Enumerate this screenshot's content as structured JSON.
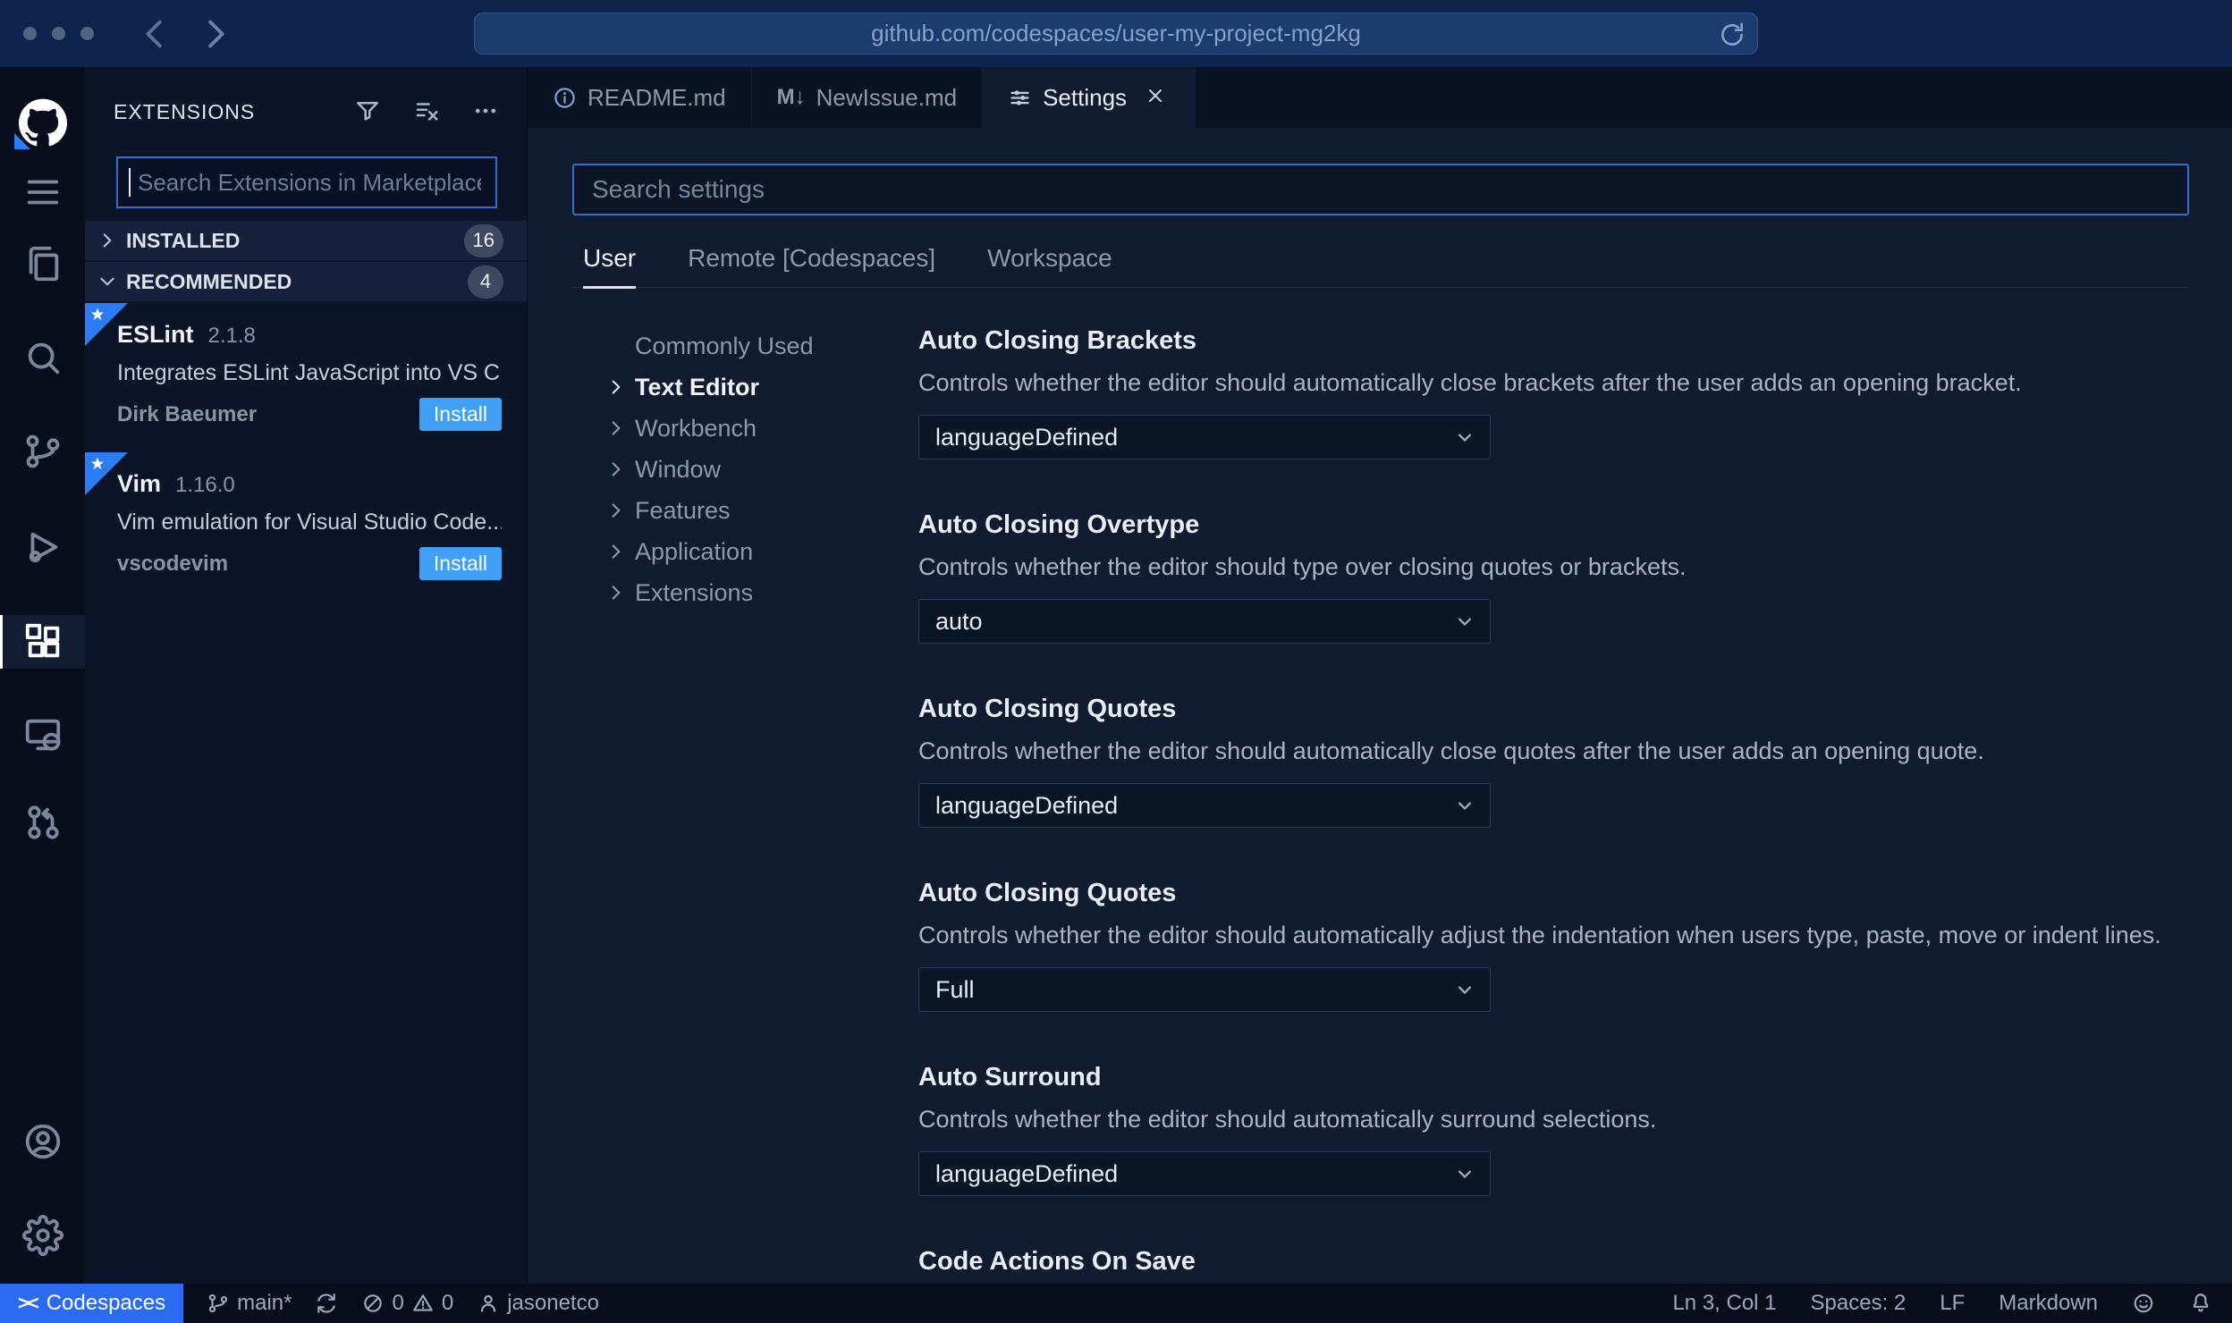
{
  "browser": {
    "url": "github.com/codespaces/user-my-project-mg2kg"
  },
  "sidebar": {
    "title": "EXTENSIONS",
    "search_placeholder": "Search Extensions in Marketplace",
    "sections": [
      {
        "label": "INSTALLED",
        "badge": "16"
      },
      {
        "label": "RECOMMENDED",
        "badge": "4"
      }
    ],
    "extensions": [
      {
        "name": "ESLint",
        "version": "2.1.8",
        "description": "Integrates ESLint JavaScript into VS C...",
        "publisher": "Dirk Baeumer",
        "action": "Install"
      },
      {
        "name": "Vim",
        "version": "1.16.0",
        "description": "Vim emulation for Visual Studio Code...",
        "publisher": "vscodevim",
        "action": "Install"
      }
    ]
  },
  "tabs": [
    {
      "label": "README.md"
    },
    {
      "label": "NewIssue.md",
      "icon_glyph": "M↓"
    },
    {
      "label": "Settings"
    }
  ],
  "settings": {
    "search_placeholder": "Search settings",
    "scopes": [
      {
        "label": "User"
      },
      {
        "label": "Remote [Codespaces]"
      },
      {
        "label": "Workspace"
      }
    ],
    "toc": [
      {
        "label": "Commonly Used"
      },
      {
        "label": "Text Editor"
      },
      {
        "label": "Workbench"
      },
      {
        "label": "Window"
      },
      {
        "label": "Features"
      },
      {
        "label": "Application"
      },
      {
        "label": "Extensions"
      }
    ],
    "items": [
      {
        "title": "Auto Closing Brackets",
        "description": "Controls whether the editor should automatically close brackets after the user adds an opening bracket.",
        "value": "languageDefined"
      },
      {
        "title": "Auto Closing Overtype",
        "description": "Controls whether the editor should type over closing quotes or brackets.",
        "value": "auto"
      },
      {
        "title": "Auto Closing Quotes",
        "description": "Controls whether the editor should automatically close quotes after the user adds an opening quote.",
        "value": "languageDefined"
      },
      {
        "title": "Auto Closing Quotes",
        "description": "Controls whether the editor should automatically adjust the indentation when users type, paste, move or indent lines.",
        "value": "Full"
      },
      {
        "title": "Auto Surround",
        "description": "Controls whether the editor should automatically surround selections.",
        "value": "languageDefined"
      },
      {
        "title": "Code Actions On Save"
      }
    ]
  },
  "status_bar": {
    "codespaces_glyph": "><",
    "codespaces_label": "Codespaces",
    "branch": "main*",
    "errors": "0",
    "warnings": "0",
    "user": "jasonetco",
    "cursor": "Ln 3, Col 1",
    "indent": "Spaces: 2",
    "eol": "LF",
    "language": "Markdown"
  }
}
